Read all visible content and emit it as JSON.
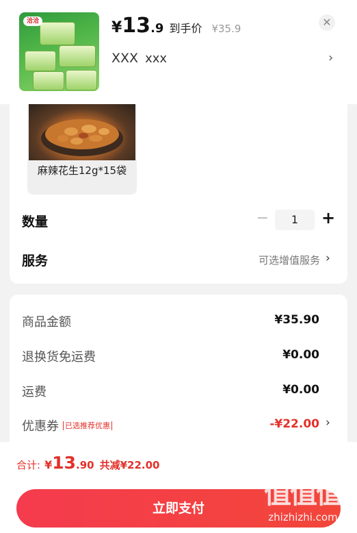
{
  "header": {
    "price_currency": "¥",
    "price_int": "13",
    "price_dec": ".9",
    "price_tag": "到手价",
    "original_price": "¥35.9",
    "spec_value": "XXX",
    "spec_value2": "xxx",
    "logo_text": "洽洽",
    "close_icon": "close-icon",
    "arrow_icon": "chevron-right-icon"
  },
  "option": {
    "label": "麻辣花生12g*15袋"
  },
  "quantity": {
    "label": "数量",
    "value": "1",
    "minus": "−",
    "plus": "+"
  },
  "service": {
    "label": "服务",
    "value": "可选增值服务"
  },
  "summary": {
    "rows": [
      {
        "label": "商品金额",
        "value": "¥35.90"
      },
      {
        "label": "退换货免运费",
        "value": "¥0.00"
      },
      {
        "label": "运费",
        "value": "¥0.00"
      },
      {
        "label": "优惠券",
        "value": "-¥22.00"
      }
    ],
    "coupon_tag": "已选推荐优惠"
  },
  "footer": {
    "total_label": "合计:",
    "total_currency": "¥",
    "total_int": "13",
    "total_dec": ".90",
    "savings": "共减¥22.00",
    "pay_button": "立即支付"
  },
  "watermark": {
    "big": "值值值",
    "small": "zhizhizhi.com"
  },
  "colors": {
    "accent": "#e2312a",
    "button": "#f33f48"
  }
}
